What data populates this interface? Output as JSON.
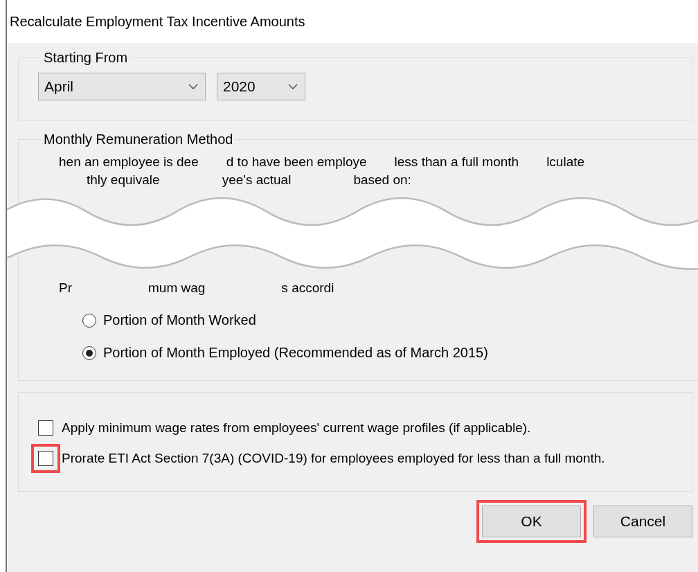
{
  "window": {
    "title": "Recalculate Employment Tax Incentive Amounts"
  },
  "starting_from": {
    "legend": "Starting From",
    "month": {
      "value": "April"
    },
    "year": {
      "value": "2020"
    }
  },
  "method": {
    "legend": "Monthly Remuneration Method",
    "torn_lines": [
      [
        "hen an employee is dee",
        "d to have been employe",
        "less than a full month",
        "lculate"
      ],
      [
        "thly equivale",
        "yee's actual",
        "based on:"
      ],
      [
        "Pr",
        "mum wag",
        "s accordi"
      ]
    ],
    "options": [
      {
        "label": "Portion of Month Worked",
        "selected": false
      },
      {
        "label": "Portion of Month Employed (Recommended as of March 2015)",
        "selected": true
      }
    ]
  },
  "checkboxes": [
    {
      "label": "Apply minimum wage rates from employees' current wage profiles (if applicable).",
      "checked": false,
      "highlighted": false
    },
    {
      "label": "Prorate ETI Act Section 7(3A) (COVID-19) for employees employed for less than a full month.",
      "checked": false,
      "highlighted": true
    }
  ],
  "buttons": [
    {
      "label": "OK",
      "highlighted": true
    },
    {
      "label": "Cancel",
      "highlighted": false
    }
  ]
}
